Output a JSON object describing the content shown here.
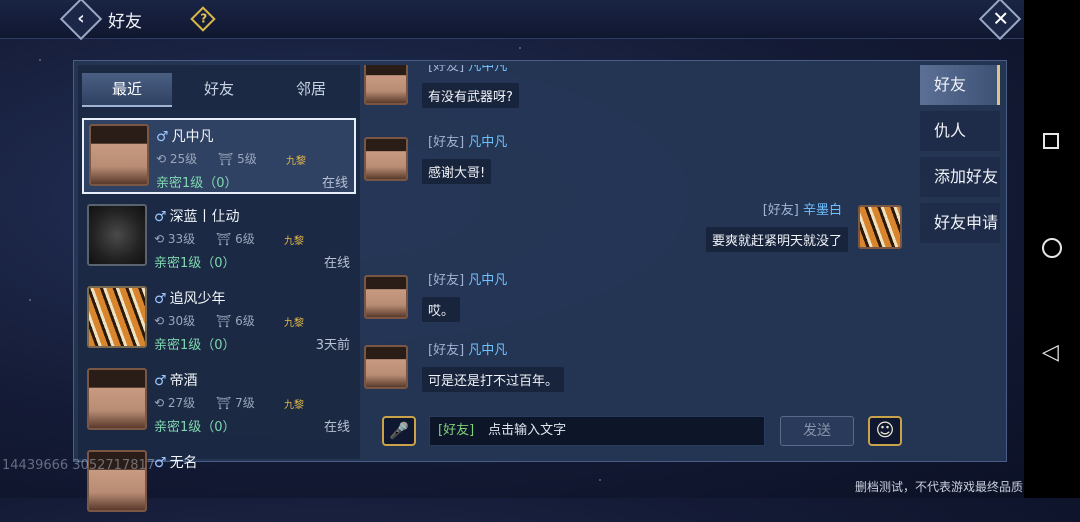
{
  "header": {
    "title": "好友",
    "back_icon": "‹",
    "help_icon": "?",
    "close_icon": "✕"
  },
  "tabs": [
    {
      "label": "最近",
      "active": true
    },
    {
      "label": "好友",
      "active": false
    },
    {
      "label": "邻居",
      "active": false
    }
  ],
  "friends": [
    {
      "name": "凡中凡",
      "level": "25级",
      "rank": "5级",
      "faction": "九黎",
      "intimacy": "亲密1级（0）",
      "status": "在线",
      "avatar": "man"
    },
    {
      "name": "深蓝丨仩动",
      "level": "33级",
      "rank": "6级",
      "faction": "九黎",
      "intimacy": "亲密1级（0）",
      "status": "在线",
      "avatar": "wolf"
    },
    {
      "name": "追风少年",
      "level": "30级",
      "rank": "6级",
      "faction": "九黎",
      "intimacy": "亲密1级（0）",
      "status": "3天前",
      "avatar": "tiger"
    },
    {
      "name": "帝酒",
      "level": "27级",
      "rank": "7级",
      "faction": "九黎",
      "intimacy": "亲密1级（0）",
      "status": "在线",
      "avatar": "man"
    },
    {
      "name": "无名",
      "level": "",
      "rank": "",
      "faction": "",
      "intimacy": "",
      "status": "",
      "avatar": "man"
    }
  ],
  "messages": [
    {
      "channel": "[好友]",
      "name": "凡中凡",
      "text": "有没有武器呀?",
      "side": "left"
    },
    {
      "channel": "[好友]",
      "name": "凡中凡",
      "text": "感谢大哥!",
      "side": "left"
    },
    {
      "channel": "[好友]",
      "name": "辛墨白",
      "text": "要爽就赶紧明天就没了",
      "side": "right"
    },
    {
      "channel": "[好友]",
      "name": "凡中凡",
      "text": "哎。",
      "side": "left"
    },
    {
      "channel": "[好友]",
      "name": "凡中凡",
      "text": "可是还是打不过百年。",
      "side": "left"
    }
  ],
  "input": {
    "channel": "[好友]",
    "placeholder": "点击输入文字",
    "send_label": "发送"
  },
  "side_menu": [
    {
      "label": "好友",
      "active": true
    },
    {
      "label": "仇人",
      "active": false
    },
    {
      "label": "添加好友",
      "active": false
    },
    {
      "label": "好友申请",
      "active": false
    }
  ],
  "footer": {
    "uid": "14439666 3052717817",
    "disclaimer": "删档测试，不代表游戏最终品质"
  },
  "colors": {
    "accent": "#e3b84b",
    "intimacy": "#7fd7b0",
    "name_link": "#6fc1ff"
  }
}
